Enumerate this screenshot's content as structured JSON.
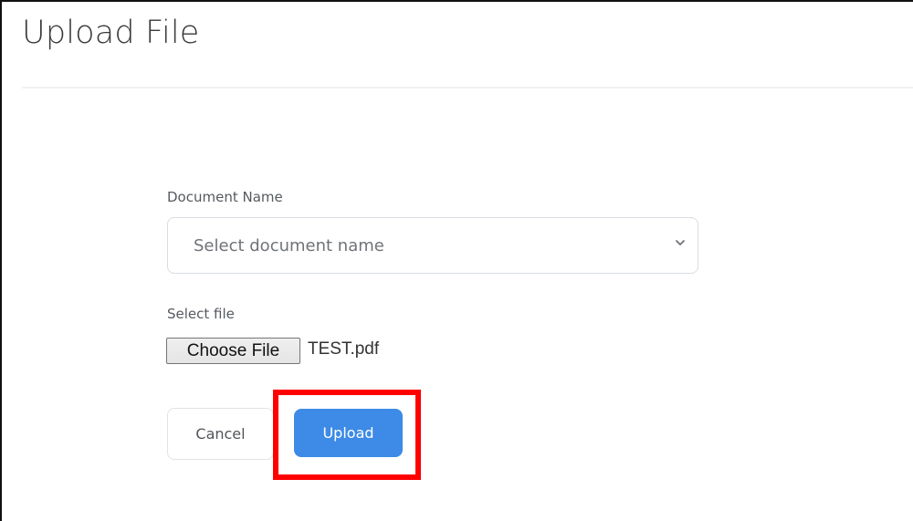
{
  "page": {
    "title": "Upload File"
  },
  "form": {
    "document_name_label": "Document Name",
    "document_name_placeholder": "Select document name",
    "select_file_label": "Select file",
    "choose_file_label": "Choose File",
    "selected_file_name": "TEST.pdf"
  },
  "actions": {
    "cancel_label": "Cancel",
    "upload_label": "Upload"
  },
  "colors": {
    "primary_button": "#3d8be6",
    "highlight": "#ff0000",
    "title_text": "#3a3a3a"
  },
  "icons": {
    "select_indicator": "chevron-down-icon"
  }
}
